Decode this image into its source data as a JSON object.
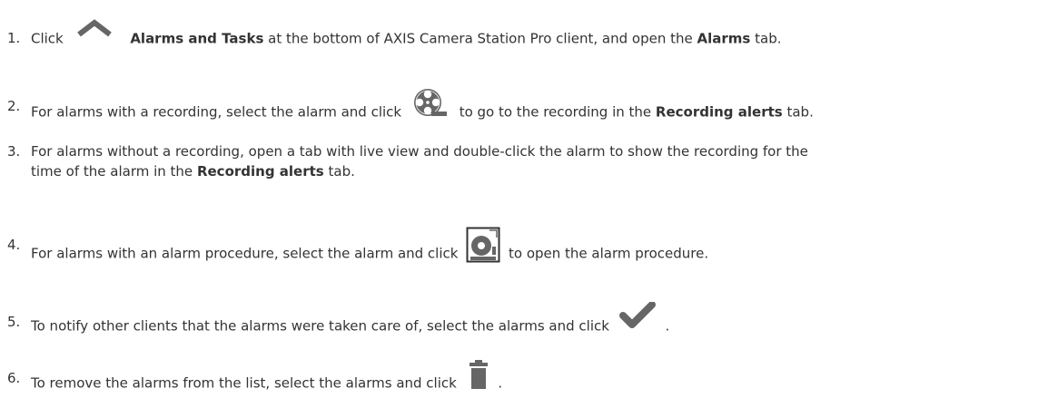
{
  "steps": [
    {
      "number": "1.",
      "t1": "Click",
      "b1": "Alarms and Tasks",
      "t2": "at the bottom of AXIS Camera Station Pro client, and open the",
      "b2": "Alarms",
      "t3": "tab.",
      "icon": "chevron-up-icon"
    },
    {
      "number": "2.",
      "t1": "For alarms with a recording, select the alarm and click",
      "t2": "to go to the recording in the",
      "b1": "Recording alerts",
      "t3": "tab.",
      "icon": "film-reel-icon"
    },
    {
      "number": "3.",
      "line1": "For alarms without a recording, open a tab with live view and double-click the alarm to show the recording for the",
      "line2a": "time of the alarm in the",
      "b1": "Recording alerts",
      "line2b": "tab."
    },
    {
      "number": "4.",
      "t1": "For alarms with an alarm procedure, select the alarm and click",
      "t2": "to open the alarm procedure.",
      "icon": "alarm-procedure-icon"
    },
    {
      "number": "5.",
      "t1": "To notify other clients that the alarms were taken care of, select the alarms and click",
      "t2": ".",
      "icon": "checkmark-icon"
    },
    {
      "number": "6.",
      "t1": "To remove the alarms from the list, select the alarms and click",
      "t2": ".",
      "icon": "trash-icon"
    }
  ],
  "colors": {
    "text": "#333333",
    "icon": "#666666"
  }
}
